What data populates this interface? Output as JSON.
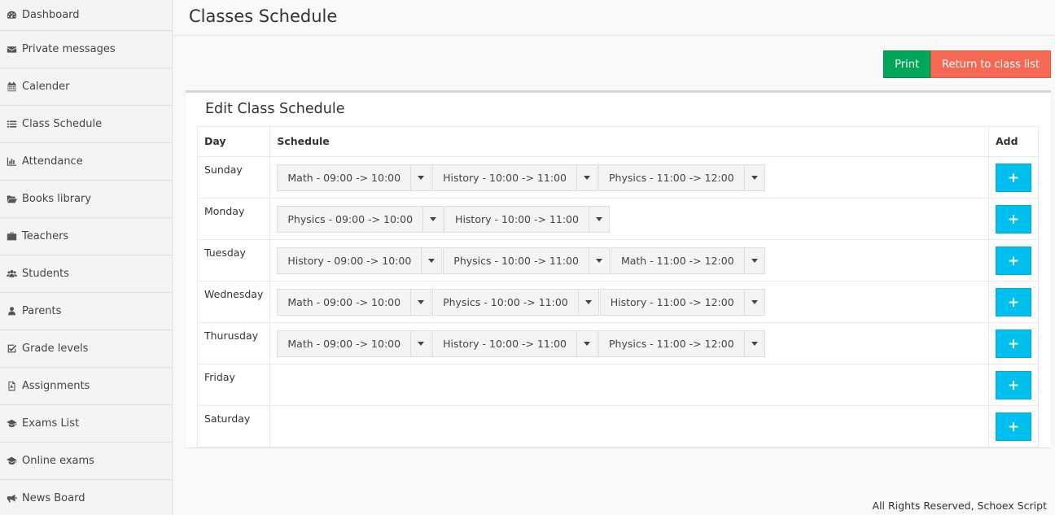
{
  "sidebar": {
    "items": [
      {
        "label": "Dashboard",
        "icon": "dashboard-icon"
      },
      {
        "label": "Private messages",
        "icon": "envelope-icon"
      },
      {
        "label": "Calender",
        "icon": "calendar-icon"
      },
      {
        "label": "Class Schedule",
        "icon": "list-icon"
      },
      {
        "label": "Attendance",
        "icon": "bar-chart-icon"
      },
      {
        "label": "Books library",
        "icon": "folder-open-icon"
      },
      {
        "label": "Teachers",
        "icon": "briefcase-icon"
      },
      {
        "label": "Students",
        "icon": "users-icon"
      },
      {
        "label": "Parents",
        "icon": "user-icon"
      },
      {
        "label": "Grade levels",
        "icon": "check-square-icon"
      },
      {
        "label": "Assignments",
        "icon": "file-pdf-icon"
      },
      {
        "label": "Exams List",
        "icon": "graduation-cap-icon"
      },
      {
        "label": "Online exams",
        "icon": "graduation-cap-icon"
      },
      {
        "label": "News Board",
        "icon": "bullhorn-icon"
      }
    ]
  },
  "header": {
    "title": "Classes Schedule"
  },
  "actions": {
    "print": "Print",
    "return": "Return to class list"
  },
  "box": {
    "title": "Edit Class Schedule",
    "columns": {
      "day": "Day",
      "schedule": "Schedule",
      "add": "Add"
    },
    "add_symbol": "+",
    "rows": [
      {
        "day": "Sunday",
        "slots": [
          "Math - 09:00 -> 10:00",
          "History - 10:00 -> 11:00",
          "Physics - 11:00 -> 12:00"
        ]
      },
      {
        "day": "Monday",
        "slots": [
          "Physics - 09:00 -> 10:00",
          "History - 10:00 -> 11:00"
        ]
      },
      {
        "day": "Tuesday",
        "slots": [
          "History - 09:00 -> 10:00",
          "Physics - 10:00 -> 11:00",
          "Math - 11:00 -> 12:00"
        ]
      },
      {
        "day": "Wednesday",
        "slots": [
          "Math - 09:00 -> 10:00",
          "Physics - 10:00 -> 11:00",
          "History - 11:00 -> 12:00"
        ]
      },
      {
        "day": "Thurusday",
        "slots": [
          "Math - 09:00 -> 10:00",
          "History - 10:00 -> 11:00",
          "Physics - 11:00 -> 12:00"
        ]
      },
      {
        "day": "Friday",
        "slots": []
      },
      {
        "day": "Saturday",
        "slots": []
      }
    ]
  },
  "footer": {
    "text": "All Rights Reserved, Schoex Script"
  },
  "colors": {
    "print": "#00a65a",
    "return": "#f56954",
    "add": "#00c0ef"
  }
}
